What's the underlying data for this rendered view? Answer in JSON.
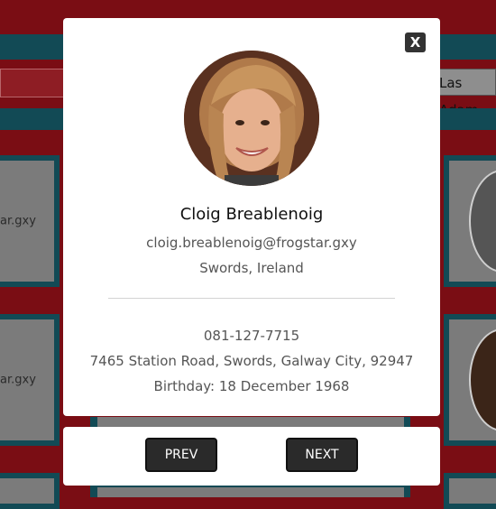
{
  "background": {
    "search_right_text": "Las Adam",
    "card_email_fragment": "ar.gxy"
  },
  "modal": {
    "close_label": "X",
    "name": "Cloig Breablenoig",
    "email": "cloig.breablenoig@frogstar.gxy",
    "location": "Swords, Ireland",
    "phone": "081-127-7715",
    "address": "7465 Station Road, Swords, Galway City, 92947",
    "birthday": "Birthday: 18 December 1968"
  },
  "nav": {
    "prev_label": "PREV",
    "next_label": "NEXT"
  },
  "colors": {
    "page_bg": "#7a0d14",
    "teal": "#124a55",
    "button": "#2a2a2a"
  }
}
